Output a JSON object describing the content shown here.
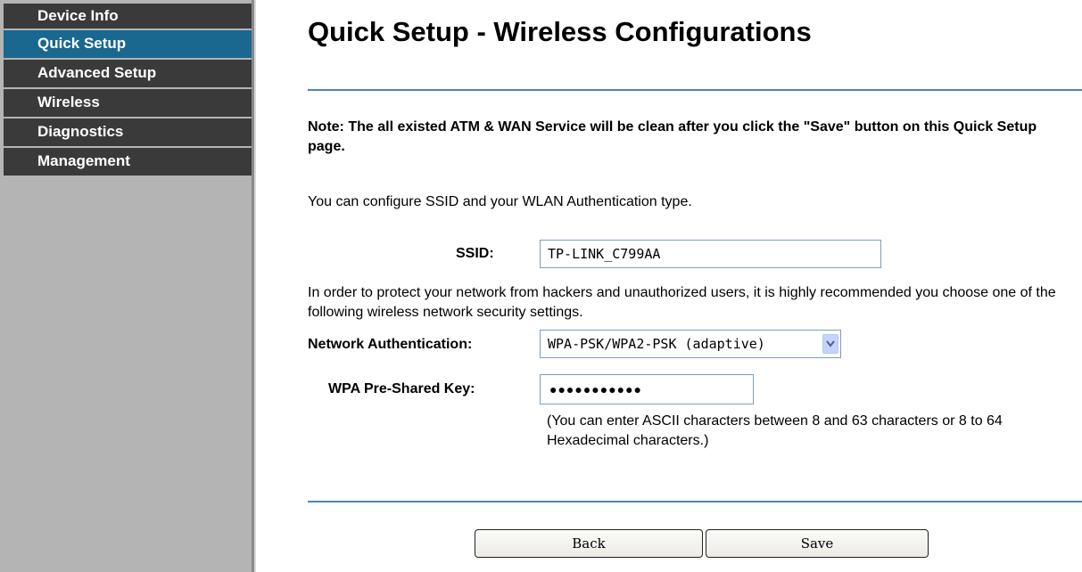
{
  "sidebar": {
    "items": [
      {
        "label": "Device Info",
        "active": false
      },
      {
        "label": "Quick Setup",
        "active": true
      },
      {
        "label": "Advanced Setup",
        "active": false
      },
      {
        "label": "Wireless",
        "active": false
      },
      {
        "label": "Diagnostics",
        "active": false
      },
      {
        "label": "Management",
        "active": false
      }
    ]
  },
  "page": {
    "title": "Quick Setup - Wireless Configurations",
    "note": "Note: The all existed ATM & WAN Service will be clean after you click the \"Save\" button on this Quick Setup page.",
    "intro": "You can configure SSID and your WLAN Authentication type.",
    "protect_text": "In order to protect your network from hackers and unauthorized users, it is highly recommended you choose one of the following wireless network security settings.",
    "hint": "(You can enter ASCII characters between 8 and 63 characters or 8 to 64 Hexadecimal characters.)"
  },
  "form": {
    "ssid_label": "SSID:",
    "ssid_value": "TP-LINK_C799AA",
    "auth_label": "Network Authentication:",
    "auth_value": "WPA-PSK/WPA2-PSK (adaptive)",
    "psk_label": "WPA Pre-Shared Key:",
    "psk_masked": "●●●●●●●●●●●"
  },
  "buttons": {
    "back": "Back",
    "save": "Save"
  },
  "colors": {
    "sidebar_bg": "#b4b4b4",
    "menu_item": "#3a3a3a",
    "menu_active": "#1a6790",
    "divider_line": "#4a86b4"
  },
  "icons": {
    "dropdown": "chevron-down-icon"
  }
}
